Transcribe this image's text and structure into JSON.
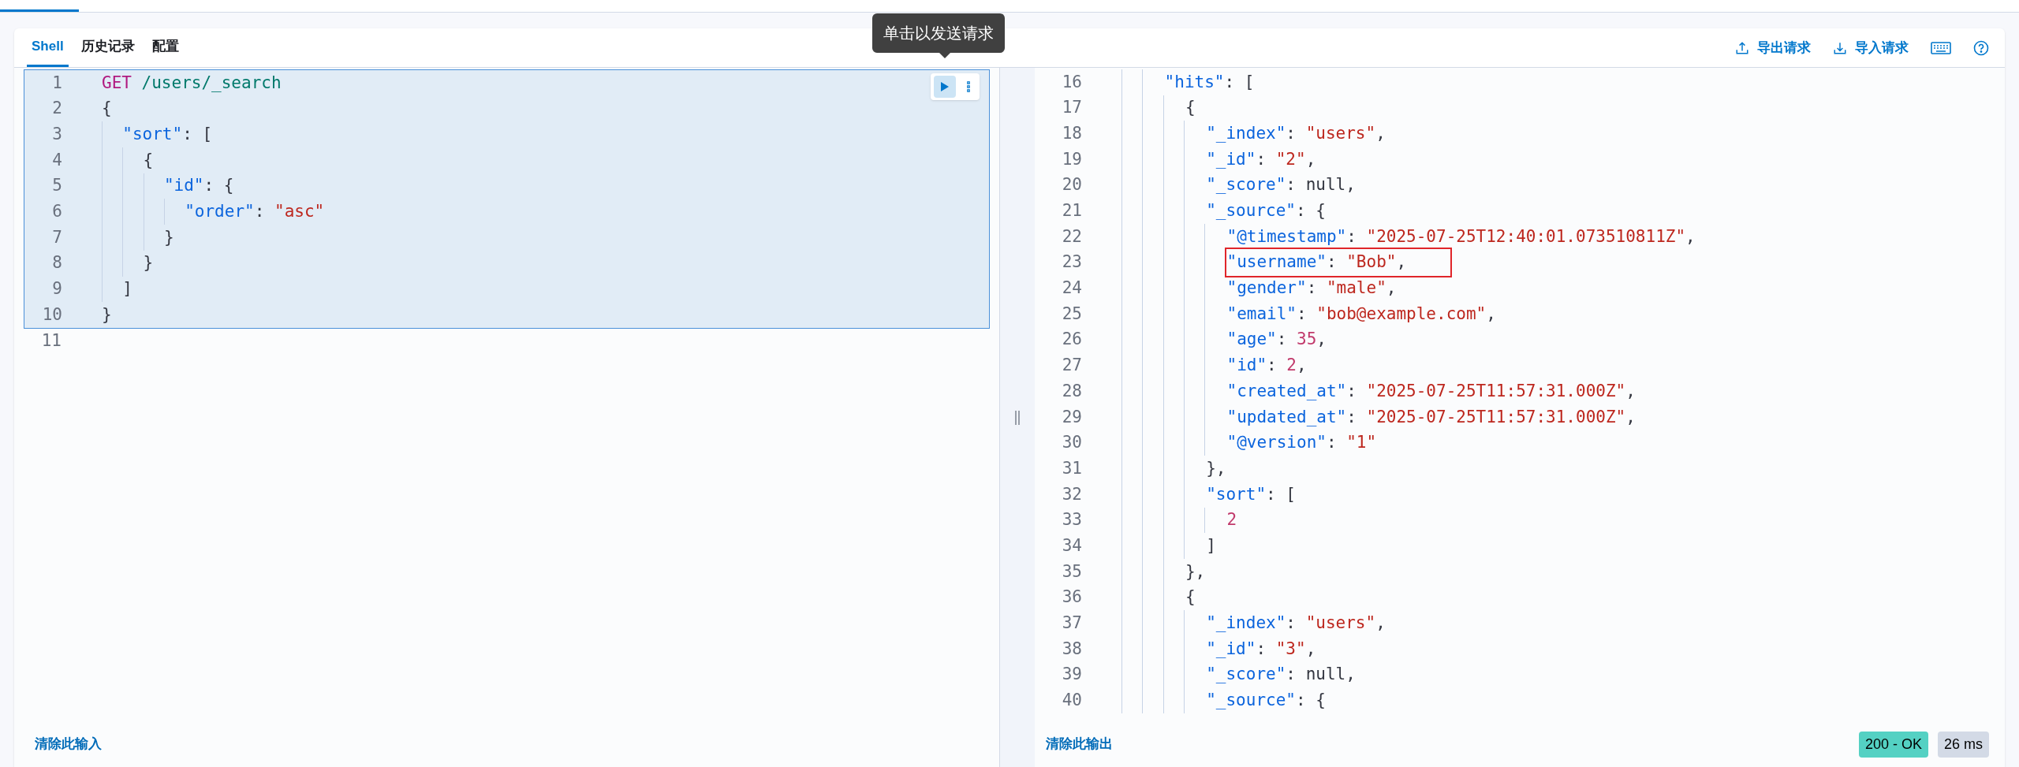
{
  "tabs": [
    {
      "label": "Shell",
      "selected": true
    },
    {
      "label": "历史记录",
      "selected": false
    },
    {
      "label": "配置",
      "selected": false
    }
  ],
  "actions": [
    {
      "kind": "export",
      "label": "导出请求"
    },
    {
      "kind": "import",
      "label": "导入请求"
    },
    {
      "kind": "keyboard"
    },
    {
      "kind": "help"
    }
  ],
  "tooltip": "单击以发送请求",
  "input": {
    "request_lines": [
      {
        "n": "1",
        "tokens": [
          {
            "kind": "method",
            "text": "GET"
          },
          {
            "kind": "path",
            "text": " /users/_search"
          }
        ]
      },
      {
        "n": "2",
        "tokens": [
          {
            "kind": "punct",
            "text": "{"
          }
        ]
      },
      {
        "n": "3",
        "tokens": [
          {
            "kind": "key",
            "text": "  \"sort\""
          },
          {
            "kind": "punct",
            "text": ": ["
          }
        ]
      },
      {
        "n": "4",
        "tokens": [
          {
            "kind": "punct",
            "text": "    {"
          }
        ]
      },
      {
        "n": "5",
        "tokens": [
          {
            "kind": "key",
            "text": "      \"id\""
          },
          {
            "kind": "punct",
            "text": ": {"
          }
        ]
      },
      {
        "n": "6",
        "tokens": [
          {
            "kind": "key",
            "text": "        \"order\""
          },
          {
            "kind": "punct",
            "text": ": "
          },
          {
            "kind": "string",
            "text": "\"asc\""
          }
        ]
      },
      {
        "n": "7",
        "tokens": [
          {
            "kind": "punct",
            "text": "      }"
          }
        ]
      },
      {
        "n": "8",
        "tokens": [
          {
            "kind": "punct",
            "text": "    }"
          }
        ]
      },
      {
        "n": "9",
        "tokens": [
          {
            "kind": "punct",
            "text": "  ]"
          }
        ]
      },
      {
        "n": "10",
        "tokens": [
          {
            "kind": "punct",
            "text": "}"
          }
        ]
      }
    ],
    "other_lines": [
      {
        "n": "11"
      }
    ],
    "clear_link": "清除此输入"
  },
  "output": {
    "lines": [
      {
        "n": "16",
        "highlighted": false,
        "tokens": [
          {
            "kind": "key",
            "text": "    \"hits\""
          },
          {
            "kind": "punct",
            "text": ": ["
          }
        ]
      },
      {
        "n": "17",
        "highlighted": false,
        "tokens": [
          {
            "kind": "punct",
            "text": "      {"
          }
        ]
      },
      {
        "n": "18",
        "highlighted": false,
        "tokens": [
          {
            "kind": "key",
            "text": "        \"_index\""
          },
          {
            "kind": "punct",
            "text": ": "
          },
          {
            "kind": "string",
            "text": "\"users\""
          },
          {
            "kind": "punct",
            "text": ","
          }
        ]
      },
      {
        "n": "19",
        "highlighted": false,
        "tokens": [
          {
            "kind": "key",
            "text": "        \"_id\""
          },
          {
            "kind": "punct",
            "text": ": "
          },
          {
            "kind": "string",
            "text": "\"2\""
          },
          {
            "kind": "punct",
            "text": ","
          }
        ]
      },
      {
        "n": "20",
        "highlighted": false,
        "tokens": [
          {
            "kind": "key",
            "text": "        \"_score\""
          },
          {
            "kind": "punct",
            "text": ": null,"
          }
        ]
      },
      {
        "n": "21",
        "highlighted": false,
        "tokens": [
          {
            "kind": "key",
            "text": "        \"_source\""
          },
          {
            "kind": "punct",
            "text": ": {"
          }
        ]
      },
      {
        "n": "22",
        "highlighted": false,
        "tokens": [
          {
            "kind": "key",
            "text": "          \"@timestamp\""
          },
          {
            "kind": "punct",
            "text": ": "
          },
          {
            "kind": "string",
            "text": "\"2025-07-25T12:40:01.073510811Z\""
          },
          {
            "kind": "punct",
            "text": ","
          }
        ]
      },
      {
        "n": "23",
        "highlighted": true,
        "tokens": [
          {
            "kind": "key",
            "text": "          \"username\""
          },
          {
            "kind": "punct",
            "text": ": "
          },
          {
            "kind": "string",
            "text": "\"Bob\""
          },
          {
            "kind": "punct",
            "text": ","
          }
        ]
      },
      {
        "n": "24",
        "highlighted": false,
        "tokens": [
          {
            "kind": "key",
            "text": "          \"gender\""
          },
          {
            "kind": "punct",
            "text": ": "
          },
          {
            "kind": "string",
            "text": "\"male\""
          },
          {
            "kind": "punct",
            "text": ","
          }
        ]
      },
      {
        "n": "25",
        "highlighted": false,
        "tokens": [
          {
            "kind": "key",
            "text": "          \"email\""
          },
          {
            "kind": "punct",
            "text": ": "
          },
          {
            "kind": "string",
            "text": "\"bob@example.com\""
          },
          {
            "kind": "punct",
            "text": ","
          }
        ]
      },
      {
        "n": "26",
        "highlighted": false,
        "tokens": [
          {
            "kind": "key",
            "text": "          \"age\""
          },
          {
            "kind": "punct",
            "text": ": "
          },
          {
            "kind": "number",
            "text": "35"
          },
          {
            "kind": "punct",
            "text": ","
          }
        ]
      },
      {
        "n": "27",
        "highlighted": false,
        "tokens": [
          {
            "kind": "key",
            "text": "          \"id\""
          },
          {
            "kind": "punct",
            "text": ": "
          },
          {
            "kind": "number",
            "text": "2"
          },
          {
            "kind": "punct",
            "text": ","
          }
        ]
      },
      {
        "n": "28",
        "highlighted": false,
        "tokens": [
          {
            "kind": "key",
            "text": "          \"created_at\""
          },
          {
            "kind": "punct",
            "text": ": "
          },
          {
            "kind": "string",
            "text": "\"2025-07-25T11:57:31.000Z\""
          },
          {
            "kind": "punct",
            "text": ","
          }
        ]
      },
      {
        "n": "29",
        "highlighted": false,
        "tokens": [
          {
            "kind": "key",
            "text": "          \"updated_at\""
          },
          {
            "kind": "punct",
            "text": ": "
          },
          {
            "kind": "string",
            "text": "\"2025-07-25T11:57:31.000Z\""
          },
          {
            "kind": "punct",
            "text": ","
          }
        ]
      },
      {
        "n": "30",
        "highlighted": false,
        "tokens": [
          {
            "kind": "key",
            "text": "          \"@version\""
          },
          {
            "kind": "punct",
            "text": ": "
          },
          {
            "kind": "string",
            "text": "\"1\""
          }
        ]
      },
      {
        "n": "31",
        "highlighted": false,
        "tokens": [
          {
            "kind": "punct",
            "text": "        },"
          }
        ]
      },
      {
        "n": "32",
        "highlighted": false,
        "tokens": [
          {
            "kind": "key",
            "text": "        \"sort\""
          },
          {
            "kind": "punct",
            "text": ": ["
          }
        ]
      },
      {
        "n": "33",
        "highlighted": false,
        "tokens": [
          {
            "kind": "number",
            "text": "          2"
          }
        ]
      },
      {
        "n": "34",
        "highlighted": false,
        "tokens": [
          {
            "kind": "punct",
            "text": "        ]"
          }
        ]
      },
      {
        "n": "35",
        "highlighted": false,
        "tokens": [
          {
            "kind": "punct",
            "text": "      },"
          }
        ]
      },
      {
        "n": "36",
        "highlighted": false,
        "tokens": [
          {
            "kind": "punct",
            "text": "      {"
          }
        ]
      },
      {
        "n": "37",
        "highlighted": false,
        "tokens": [
          {
            "kind": "key",
            "text": "        \"_index\""
          },
          {
            "kind": "punct",
            "text": ": "
          },
          {
            "kind": "string",
            "text": "\"users\""
          },
          {
            "kind": "punct",
            "text": ","
          }
        ]
      },
      {
        "n": "38",
        "highlighted": false,
        "tokens": [
          {
            "kind": "key",
            "text": "        \"_id\""
          },
          {
            "kind": "punct",
            "text": ": "
          },
          {
            "kind": "string",
            "text": "\"3\""
          },
          {
            "kind": "punct",
            "text": ","
          }
        ]
      },
      {
        "n": "39",
        "highlighted": false,
        "tokens": [
          {
            "kind": "key",
            "text": "        \"_score\""
          },
          {
            "kind": "punct",
            "text": ": null,"
          }
        ]
      },
      {
        "n": "40",
        "highlighted": false,
        "tokens": [
          {
            "kind": "key",
            "text": "        \"_source\""
          },
          {
            "kind": "punct",
            "text": ": {"
          }
        ]
      }
    ],
    "clear_link": "清除此输出",
    "status": "200 - OK",
    "duration": "26 ms"
  }
}
